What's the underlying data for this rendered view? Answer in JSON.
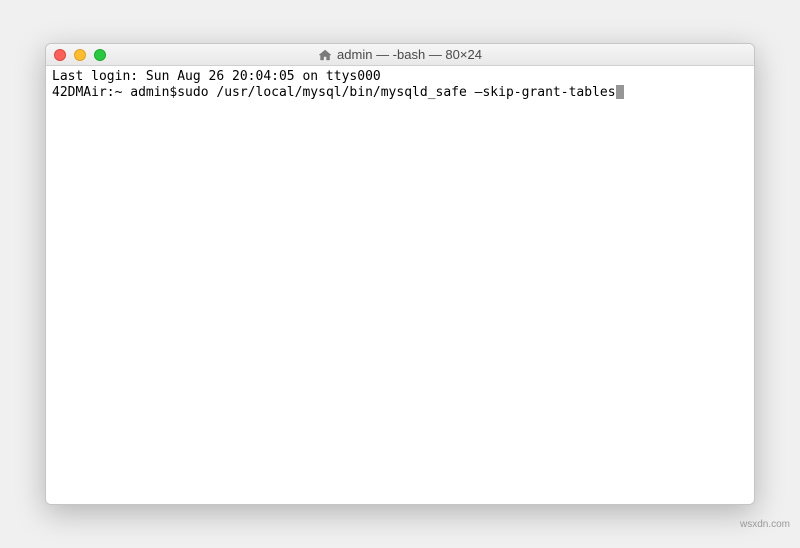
{
  "titlebar": {
    "icon": "home-icon",
    "title": "admin — -bash — 80×24"
  },
  "terminal": {
    "last_login": "Last login: Sun Aug 26 20:04:05 on ttys000",
    "prompt": "42DMAir:~ admin$ ",
    "command": "sudo /usr/local/mysql/bin/mysqld_safe –skip-grant-tables"
  },
  "watermark": "wsxdn.com"
}
